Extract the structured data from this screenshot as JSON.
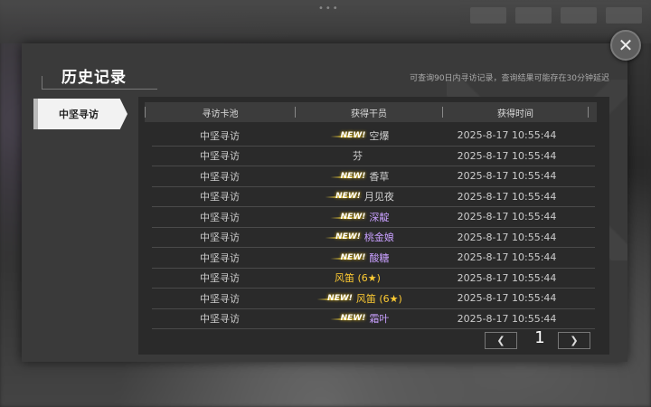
{
  "dialog": {
    "title": "历史记录",
    "subtitle": "可查询90日内寻访记录，查询结果可能存在30分钟延迟"
  },
  "sidebar": {
    "active_tab": "中坚寻访"
  },
  "table": {
    "headers": [
      "寻访卡池",
      "获得干员",
      "获得时间"
    ],
    "new_label": "NEW!",
    "rows": [
      {
        "pool": "中坚寻访",
        "is_new": true,
        "operator": "空爆",
        "color": "#cfcfcf",
        "time": "2025-8-17 10:55:44"
      },
      {
        "pool": "中坚寻访",
        "is_new": false,
        "operator": "芬",
        "color": "#cfcfcf",
        "time": "2025-8-17 10:55:44"
      },
      {
        "pool": "中坚寻访",
        "is_new": true,
        "operator": "香草",
        "color": "#cfcfcf",
        "time": "2025-8-17 10:55:44"
      },
      {
        "pool": "中坚寻访",
        "is_new": true,
        "operator": "月见夜",
        "color": "#cfcfcf",
        "time": "2025-8-17 10:55:44"
      },
      {
        "pool": "中坚寻访",
        "is_new": true,
        "operator": "深靛",
        "color": "#c9a0ff",
        "time": "2025-8-17 10:55:44"
      },
      {
        "pool": "中坚寻访",
        "is_new": true,
        "operator": "桃金娘",
        "color": "#c9a0ff",
        "time": "2025-8-17 10:55:44"
      },
      {
        "pool": "中坚寻访",
        "is_new": true,
        "operator": "酸糖",
        "color": "#c9a0ff",
        "time": "2025-8-17 10:55:44"
      },
      {
        "pool": "中坚寻访",
        "is_new": false,
        "operator": "风笛 (6★)",
        "color": "#ffcc33",
        "time": "2025-8-17 10:55:44"
      },
      {
        "pool": "中坚寻访",
        "is_new": true,
        "operator": "风笛 (6★)",
        "color": "#ffcc33",
        "time": "2025-8-17 10:55:44"
      },
      {
        "pool": "中坚寻访",
        "is_new": true,
        "operator": "霜叶",
        "color": "#c9a0ff",
        "time": "2025-8-17 10:55:44"
      }
    ]
  },
  "pager": {
    "current_page": "1",
    "prev_icon": "chevron-left-icon",
    "next_icon": "chevron-right-icon"
  },
  "icons": {
    "close": "close-icon"
  }
}
